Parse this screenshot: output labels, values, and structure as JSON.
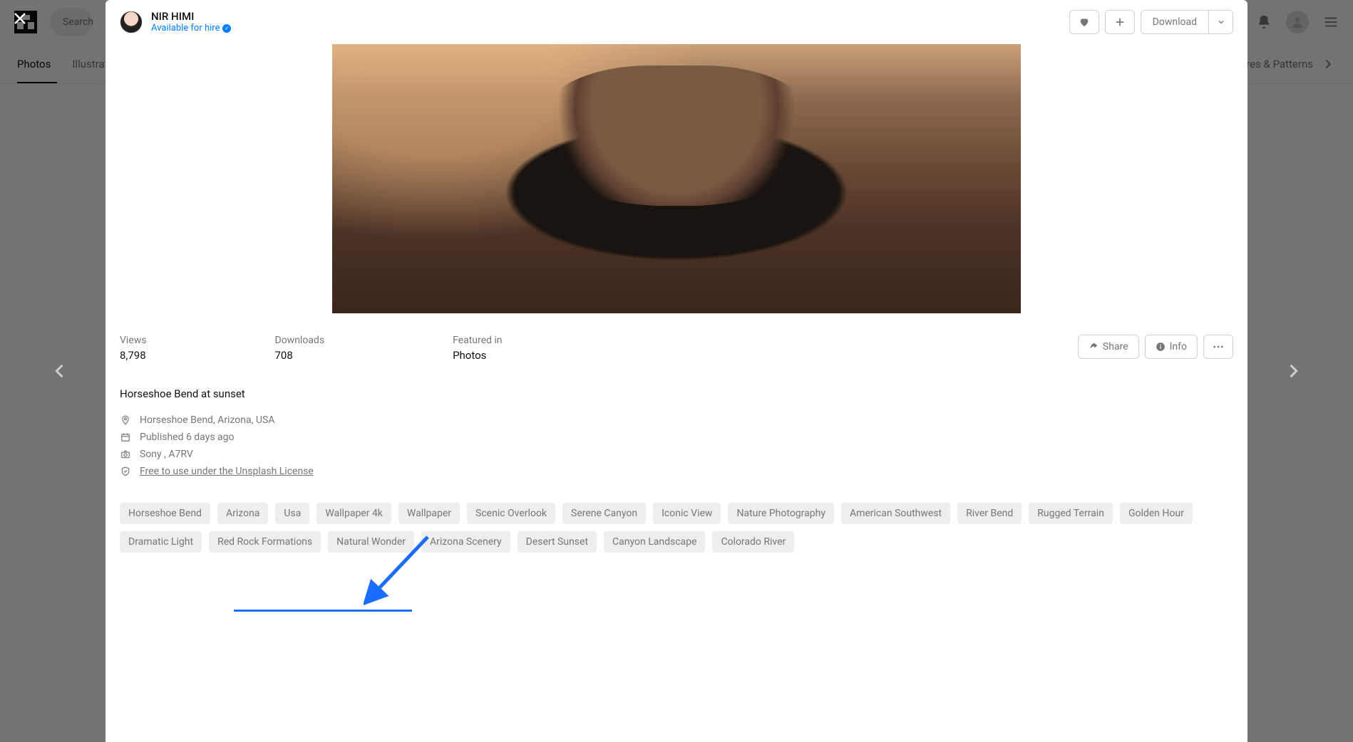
{
  "bg": {
    "tabs": {
      "photos": "Photos",
      "illustrations": "Illustrations",
      "textures": "Textures & Patterns"
    },
    "search_placeholder": "Search"
  },
  "author": {
    "name": "NIR HIMI",
    "hire": "Available for hire"
  },
  "actions": {
    "download": "Download",
    "share": "Share",
    "info": "Info"
  },
  "stats": {
    "views_label": "Views",
    "views_value": "8,798",
    "downloads_label": "Downloads",
    "downloads_value": "708",
    "featured_label": "Featured in",
    "featured_value": "Photos"
  },
  "description": "Horseshoe Bend at sunset",
  "meta": {
    "location": "Horseshoe Bend, Arizona, USA",
    "published": "Published 6 days ago",
    "camera": "Sony , A7RV",
    "license_prefix": "Free to use under the ",
    "license_link": "Unsplash License"
  },
  "tags": [
    "Horseshoe Bend",
    "Arizona",
    "Usa",
    "Wallpaper 4k",
    "Wallpaper",
    "Scenic Overlook",
    "Serene Canyon",
    "Iconic View",
    "Nature Photography",
    "American Southwest",
    "River Bend",
    "Rugged Terrain",
    "Golden Hour",
    "Dramatic Light",
    "Red Rock Formations",
    "Natural Wonder",
    "Arizona Scenery",
    "Desert Sunset",
    "Canyon Landscape",
    "Colorado River"
  ]
}
